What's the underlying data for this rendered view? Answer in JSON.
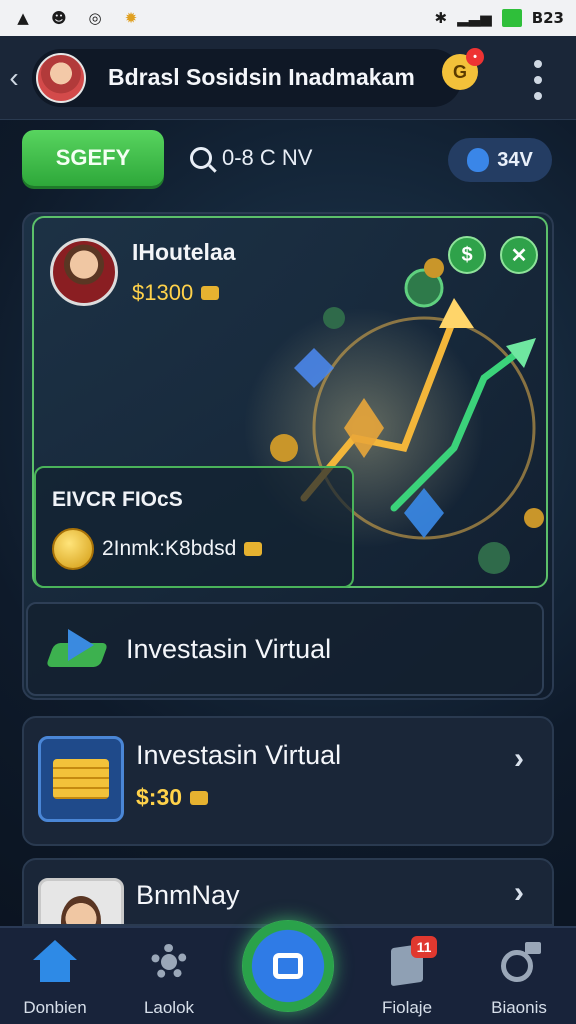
{
  "status_bar": {
    "time": "B23"
  },
  "header": {
    "title": "Bdrasl Sosidsin Inadmakam"
  },
  "action_bar": {
    "primary_button": "SGEFY",
    "search_text": "0-8 C NV",
    "balance": "34V"
  },
  "hero": {
    "profile_name": "IHoutelaa",
    "profile_balance": "$1300",
    "stats_title": "EIVCR FIOcS",
    "stats_value": "2Inmk:K8bdsd",
    "invest_label": "Investasin Virtual"
  },
  "cards": [
    {
      "title": "Investasin Virtual",
      "subtitle": "$:30"
    },
    {
      "title": "BnmNay"
    }
  ],
  "bottom_nav": {
    "items": [
      {
        "label": "Donbien",
        "icon": "home-icon"
      },
      {
        "label": "Laolok",
        "icon": "gear-icon"
      },
      {
        "label": "",
        "icon": "camera-icon"
      },
      {
        "label": "Fiolaje",
        "icon": "document-icon",
        "badge": "11"
      },
      {
        "label": "Biaonis",
        "icon": "robot-icon"
      }
    ]
  },
  "colors": {
    "accent_green": "#3db14f",
    "gold": "#ffd24a",
    "background": "#0e1a2a"
  }
}
